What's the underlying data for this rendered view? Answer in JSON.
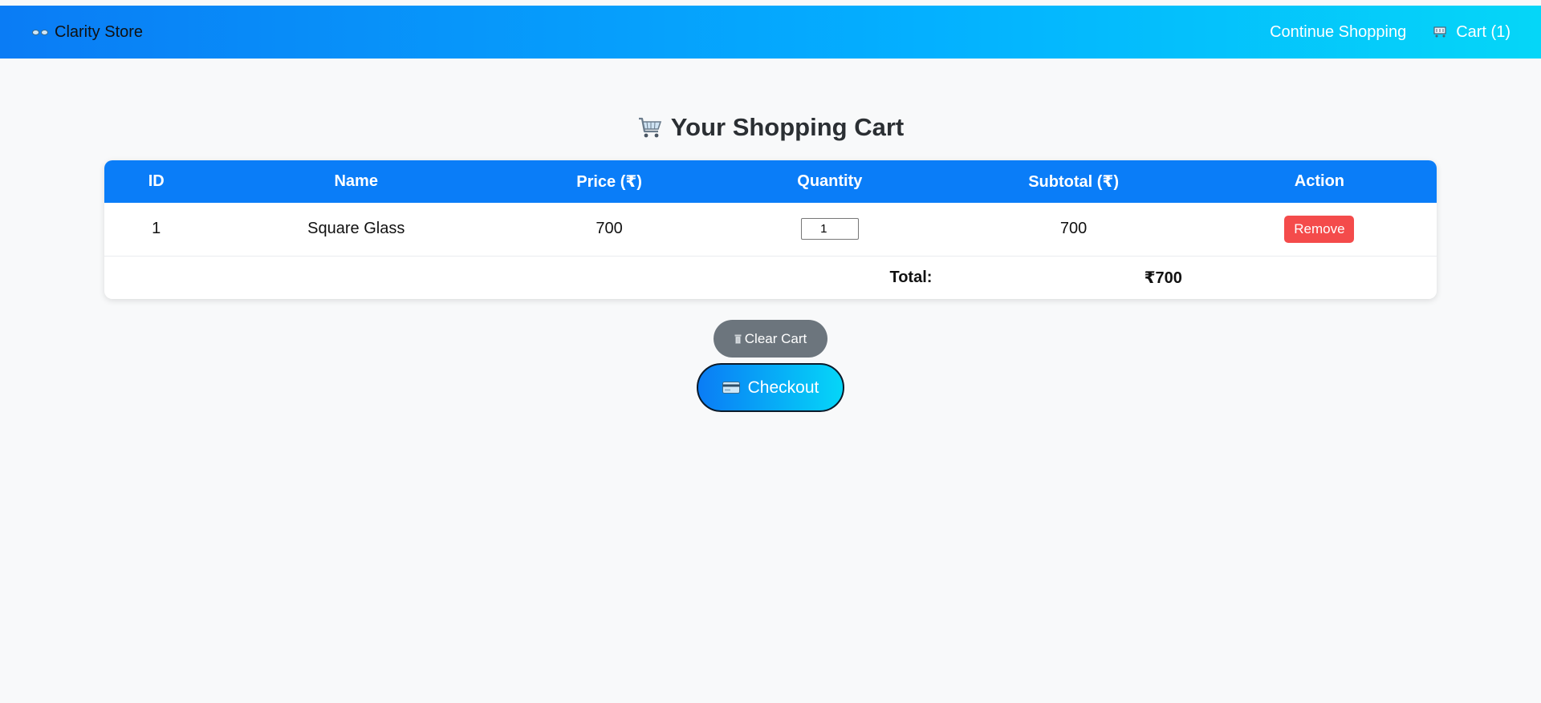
{
  "navbar": {
    "brand": "Clarity Store",
    "brand_icon": "eyeglasses-icon",
    "links": [
      {
        "label": "Continue Shopping"
      },
      {
        "label": "Cart (1)",
        "icon": "cart-icon"
      }
    ],
    "gradient_start": "#0a7cf5",
    "gradient_end": "#05d6f8"
  },
  "page": {
    "title": "Your Shopping Cart",
    "title_icon": "shopping-cart-icon"
  },
  "cart_table": {
    "headers": [
      "ID",
      "Name",
      "Price (₹)",
      "Quantity",
      "Subtotal (₹)",
      "Action"
    ],
    "rows": [
      {
        "id": "1",
        "name": "Square Glass",
        "price": "700",
        "quantity": "1",
        "subtotal": "700",
        "action": "Remove"
      }
    ],
    "total_label": "Total:",
    "total_value": "₹700",
    "header_color": "#0a7df8",
    "remove_color": "#f44b4b"
  },
  "actions": {
    "clear_label": "Clear Cart",
    "clear_icon": "trash-icon",
    "checkout_label": "Checkout",
    "checkout_icon": "credit-card-icon"
  }
}
